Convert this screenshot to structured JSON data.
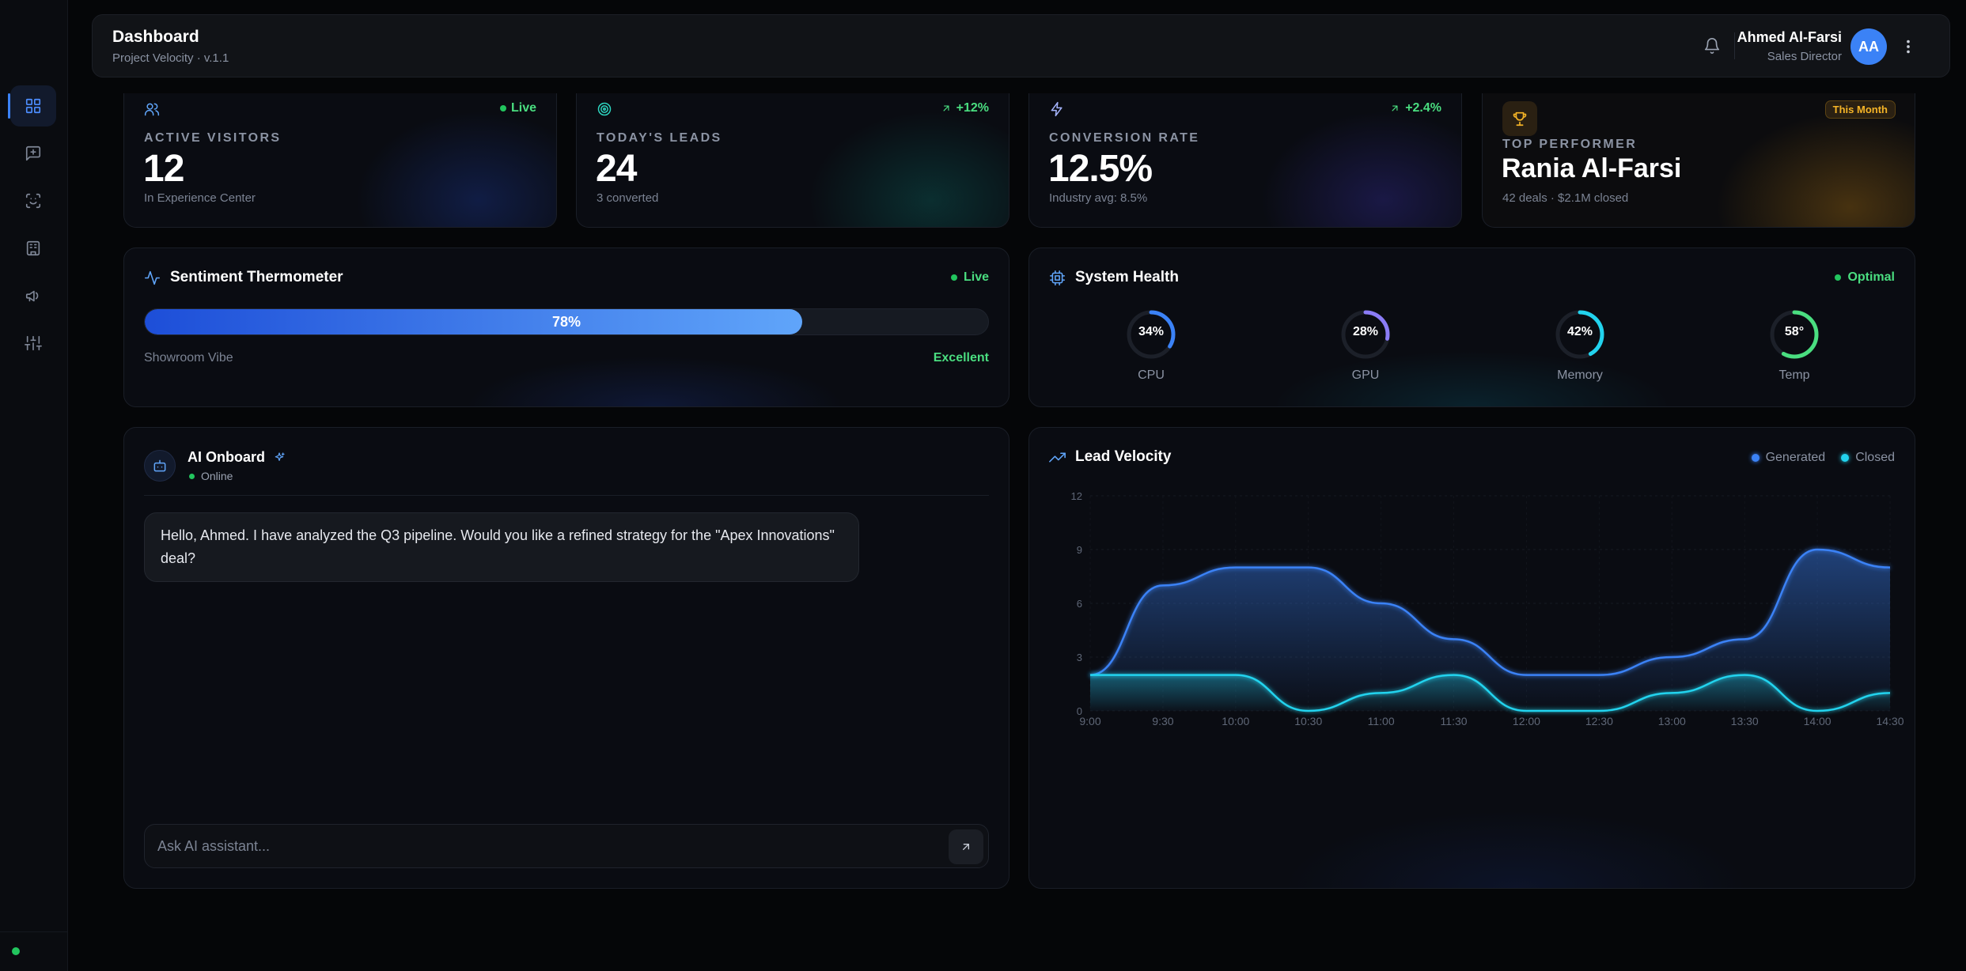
{
  "header": {
    "title": "Dashboard",
    "subtitle": "Project Velocity · v.1.1",
    "user_name": "Ahmed Al-Farsi",
    "user_role": "Sales Director",
    "avatar_initials": "AA"
  },
  "sidebar": {
    "items": [
      {
        "icon": "grid-icon",
        "active": true
      },
      {
        "icon": "message-plus-icon",
        "active": false
      },
      {
        "icon": "scan-face-icon",
        "active": false
      },
      {
        "icon": "building-icon",
        "active": false
      },
      {
        "icon": "megaphone-icon",
        "active": false
      },
      {
        "icon": "sliders-icon",
        "active": false
      }
    ]
  },
  "stats": [
    {
      "label": "ACTIVE VISITORS",
      "value": "12",
      "note": "In Experience Center",
      "badge": "Live",
      "icon": "users-icon"
    },
    {
      "label": "TODAY'S LEADS",
      "value": "24",
      "note": "3 converted",
      "badge": "+12%",
      "icon": "target-icon"
    },
    {
      "label": "CONVERSION RATE",
      "value": "12.5%",
      "note": "Industry avg: 8.5%",
      "badge": "+2.4%",
      "icon": "zap-icon"
    }
  ],
  "top_performer": {
    "label": "TOP PERFORMER",
    "name": "Rania Al-Farsi",
    "note": "42 deals · $2.1M closed",
    "badge": "This Month"
  },
  "sentiment": {
    "title": "Sentiment Thermometer",
    "status": "Live",
    "value": 78,
    "value_label": "78%",
    "left_label": "Showroom Vibe",
    "right_label": "Excellent"
  },
  "system_health": {
    "title": "System Health",
    "status": "Optimal",
    "gauges": [
      {
        "label": "CPU",
        "value": 34,
        "text": "34%",
        "color": "#3b82f6"
      },
      {
        "label": "GPU",
        "value": 28,
        "text": "28%",
        "color": "#8b7cf6"
      },
      {
        "label": "Memory",
        "value": 42,
        "text": "42%",
        "color": "#22d3ee"
      },
      {
        "label": "Temp",
        "value": 58,
        "text": "58°",
        "color": "#4ade80"
      }
    ]
  },
  "assistant": {
    "name": "AI Onboard",
    "status": "Online",
    "message": "Hello, Ahmed. I have analyzed the Q3 pipeline. Would you like a refined strategy for the \"Apex Innovations\" deal?",
    "input_placeholder": "Ask AI assistant..."
  },
  "lead_velocity": {
    "title": "Lead Velocity"
  },
  "chart_data": {
    "type": "area",
    "x": [
      "9:00",
      "9:30",
      "10:00",
      "10:30",
      "11:00",
      "11:30",
      "12:00",
      "12:30",
      "13:00",
      "13:30",
      "14:00",
      "14:30"
    ],
    "series": [
      {
        "name": "Generated",
        "values": [
          2,
          7,
          8,
          8,
          6,
          4,
          2,
          2,
          3,
          4,
          9,
          8
        ],
        "color": "#3b82f6"
      },
      {
        "name": "Closed",
        "values": [
          2,
          2,
          2,
          0,
          1,
          2,
          0,
          0,
          1,
          2,
          0,
          1
        ],
        "color": "#22d3ee"
      }
    ],
    "yticks": [
      0,
      3,
      6,
      9,
      12
    ],
    "ylim": [
      0,
      12
    ],
    "grid": true,
    "legend": "top-right"
  }
}
